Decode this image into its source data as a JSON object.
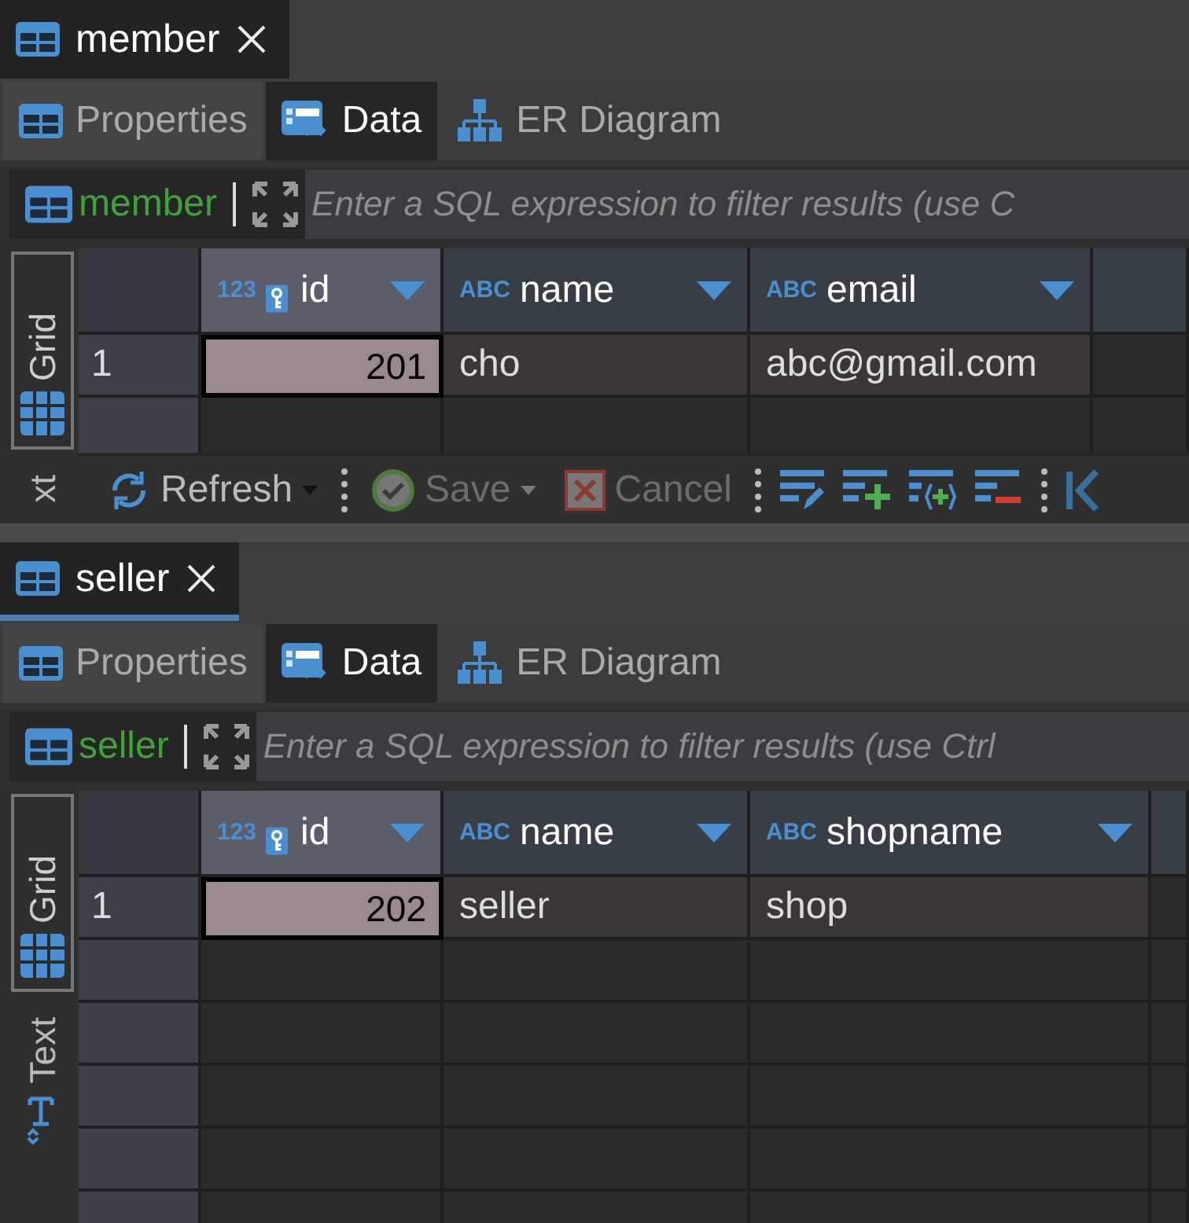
{
  "panels": [
    {
      "editor_tab": {
        "title": "member",
        "underline": false
      },
      "subtabs": [
        {
          "label": "Properties",
          "kind": "properties",
          "selected": false
        },
        {
          "label": "Data",
          "kind": "data",
          "selected": true
        },
        {
          "label": "ER Diagram",
          "kind": "diagram",
          "selected": false
        }
      ],
      "filter": {
        "table": "member",
        "placeholder": "Enter a SQL expression to filter results (use C"
      },
      "view_tabs": [
        {
          "label": "Grid",
          "kind": "grid",
          "selected": true
        },
        {
          "label": "xt",
          "kind": "text",
          "selected": false
        }
      ],
      "columns": [
        {
          "type_label": "123",
          "name": "id",
          "key": true,
          "selected": true
        },
        {
          "type_label": "ABC",
          "name": "name",
          "key": false,
          "selected": false
        },
        {
          "type_label": "ABC",
          "name": "email",
          "key": false,
          "selected": false
        }
      ],
      "rows": [
        {
          "number": "1",
          "cells": [
            {
              "text": "201",
              "selected": true
            },
            {
              "text": "cho",
              "selected": false
            },
            {
              "text": "abc@gmail.com",
              "selected": false
            }
          ]
        }
      ],
      "toolbar": [
        {
          "kind": "refresh",
          "label": "Refresh",
          "dropdown": true,
          "disabled": false
        },
        {
          "kind": "separator"
        },
        {
          "kind": "save",
          "label": "Save",
          "dropdown": true,
          "disabled": true
        },
        {
          "kind": "cancel",
          "label": "Cancel",
          "dropdown": false,
          "disabled": true
        },
        {
          "kind": "separator"
        },
        {
          "kind": "edit-row"
        },
        {
          "kind": "add-row"
        },
        {
          "kind": "copy-row"
        },
        {
          "kind": "delete-row"
        },
        {
          "kind": "separator"
        },
        {
          "kind": "first"
        }
      ]
    },
    {
      "editor_tab": {
        "title": "seller",
        "underline": true
      },
      "subtabs": [
        {
          "label": "Properties",
          "kind": "properties",
          "selected": false
        },
        {
          "label": "Data",
          "kind": "data",
          "selected": true
        },
        {
          "label": "ER Diagram",
          "kind": "diagram",
          "selected": false
        }
      ],
      "filter": {
        "table": "seller",
        "placeholder": "Enter a SQL expression to filter results (use Ctrl"
      },
      "view_tabs": [
        {
          "label": "Grid",
          "kind": "grid",
          "selected": true
        },
        {
          "label": "Text",
          "kind": "text",
          "selected": false
        }
      ],
      "columns": [
        {
          "type_label": "123",
          "name": "id",
          "key": true,
          "selected": true
        },
        {
          "type_label": "ABC",
          "name": "name",
          "key": false,
          "selected": false
        },
        {
          "type_label": "ABC",
          "name": "shopname",
          "key": false,
          "selected": false
        }
      ],
      "rows": [
        {
          "number": "1",
          "cells": [
            {
              "text": "202",
              "selected": true
            },
            {
              "text": "seller",
              "selected": false
            },
            {
              "text": "shop",
              "selected": false
            }
          ]
        }
      ]
    }
  ]
}
